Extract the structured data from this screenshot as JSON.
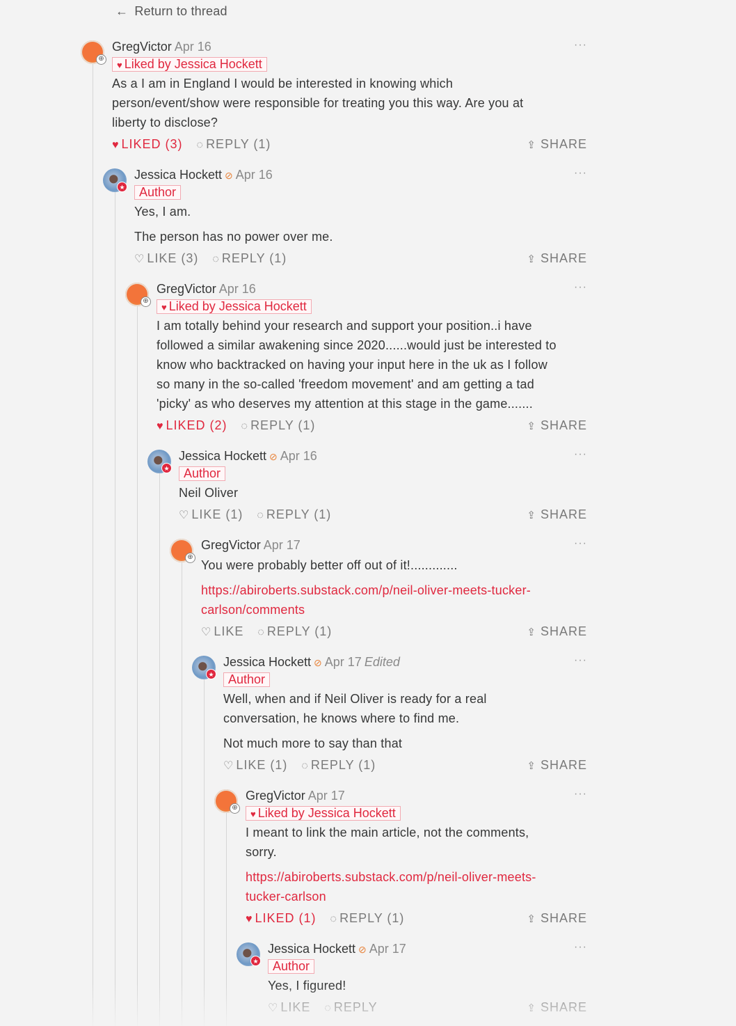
{
  "back": {
    "arrow": "←",
    "label": "Return to thread"
  },
  "comments": [
    {
      "author": "GregVictor",
      "date": "Apr 16",
      "tag": "Liked by Jessica Hockett",
      "tag_heart": "♥",
      "lines": [
        "As a I am in England I would be interested in knowing which",
        "person/event/show were responsible for treating you this way. Are you at",
        "liberty to disclose?"
      ],
      "like": "LIKED (3)",
      "reply": "REPLY (1)",
      "share": "SHARE"
    },
    {
      "author": "Jessica Hockett",
      "date": "Apr 16",
      "tag": "Author",
      "lines": [
        "Yes, I am.",
        "The person has no power over me."
      ],
      "like": "LIKE (3)",
      "reply": "REPLY (1)",
      "share": "SHARE"
    },
    {
      "author": "GregVictor",
      "date": "Apr 16",
      "tag": "Liked by Jessica Hockett",
      "tag_heart": "♥",
      "lines": [
        "I am totally behind your research and support your position..i have",
        "followed a similar awakening since 2020......would just be interested to",
        "know who backtracked on having your input here in the uk as I follow",
        "so many in the so-called 'freedom movement' and am getting a tad",
        "'picky' as who deserves my attention at this stage in the game......."
      ],
      "like": "LIKED (2)",
      "reply": "REPLY (1)",
      "share": "SHARE"
    },
    {
      "author": "Jessica Hockett",
      "date": "Apr 16",
      "tag": "Author",
      "lines": [
        "Neil Oliver"
      ],
      "like": "LIKE (1)",
      "reply": "REPLY (1)",
      "share": "SHARE"
    },
    {
      "author": "GregVictor",
      "date": "Apr 17",
      "lines": [
        "You were probably better off out of it!............."
      ],
      "link_lines": [
        "https://abiroberts.substack.com/p/neil-oliver-meets-tucker-",
        "carlson/comments"
      ],
      "like": "LIKE",
      "reply": "REPLY (1)",
      "share": "SHARE"
    },
    {
      "author": "Jessica Hockett",
      "date": "Apr 17",
      "edited": "Edited",
      "tag": "Author",
      "lines": [
        "Well, when and if Neil Oliver is ready for a real",
        "conversation, he knows where to find me.",
        "Not much more to say than that"
      ],
      "like": "LIKE (1)",
      "reply": "REPLY (1)",
      "share": "SHARE"
    },
    {
      "author": "GregVictor",
      "date": "Apr 17",
      "tag": "Liked by Jessica Hockett",
      "tag_heart": "♥",
      "lines": [
        "I meant to link the main article, not the comments,",
        "sorry."
      ],
      "link_lines": [
        "https://abiroberts.substack.com/p/neil-oliver-meets-",
        "tucker-carlson"
      ],
      "like": "LIKED (1)",
      "reply": "REPLY (1)",
      "share": "SHARE"
    },
    {
      "author": "Jessica Hockett",
      "date": "Apr 17",
      "tag": "Author",
      "lines": [
        "Yes, I figured!"
      ],
      "like": "LIKE",
      "reply": "REPLY",
      "share": "SHARE"
    }
  ],
  "icons": {
    "more": "more-dots-icon",
    "heart_filled": "heart-filled-icon",
    "heart_outline": "heart-outline-icon",
    "reply": "reply-bubble-icon",
    "share": "share-upload-icon",
    "verified": "verified-check-icon"
  },
  "colors": {
    "accent": "#e0283f",
    "muted": "#7a7a7a",
    "background": "#f3f3f3",
    "verified": "#e8833a"
  }
}
